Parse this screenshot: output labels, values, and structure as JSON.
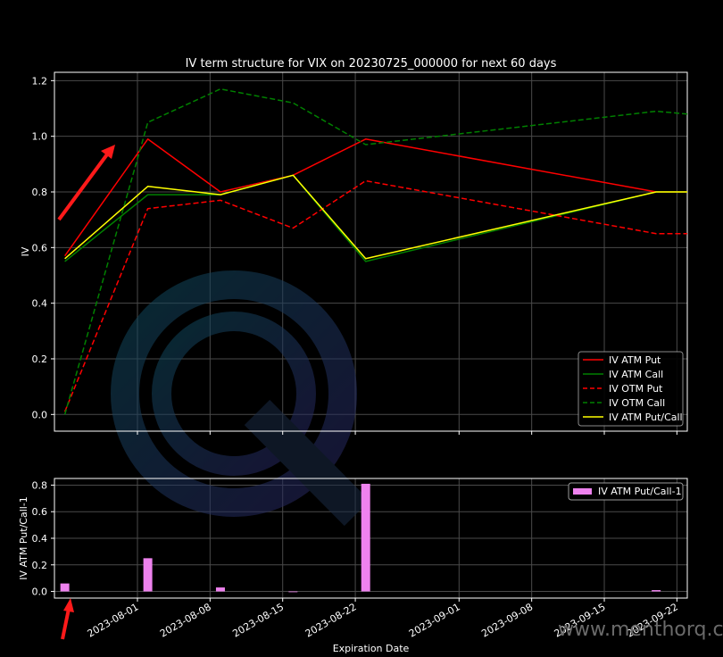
{
  "watermark_text": "www.menthorq.com",
  "chart_data": [
    {
      "type": "line",
      "title": "IV term structure for VIX on 20230725_000000 for next 60 days",
      "xlabel": "",
      "ylabel": "IV",
      "xlim": [
        "2023-07-24",
        "2023-09-23"
      ],
      "ylim": [
        -0.06,
        1.23
      ],
      "yticks": [
        "0.0",
        "0.2",
        "0.4",
        "0.6",
        "0.8",
        "1.0",
        "1.2"
      ],
      "grid": true,
      "legend_position": "lower-right",
      "x": [
        "2023-07-25",
        "2023-08-02",
        "2023-08-09",
        "2023-08-16",
        "2023-08-23",
        "2023-09-20",
        "2023-09-23"
      ],
      "series": [
        {
          "name": "IV ATM Put",
          "color": "#ff0000",
          "dash": "solid",
          "values": [
            0.57,
            0.99,
            0.8,
            0.86,
            0.99,
            0.8,
            0.8
          ]
        },
        {
          "name": "IV ATM Call",
          "color": "#008000",
          "dash": "solid",
          "values": [
            0.55,
            0.79,
            0.79,
            0.86,
            0.55,
            0.8,
            0.8
          ]
        },
        {
          "name": "IV OTM Put",
          "color": "#ff0000",
          "dash": "dashed",
          "values": [
            0.01,
            0.74,
            0.77,
            0.67,
            0.84,
            0.65,
            0.65
          ]
        },
        {
          "name": "IV OTM Call",
          "color": "#008000",
          "dash": "dashed",
          "values": [
            0.0,
            1.05,
            1.17,
            1.12,
            0.97,
            1.09,
            1.08
          ]
        },
        {
          "name": "IV ATM Put/Call",
          "color": "#ffff00",
          "dash": "solid",
          "values": [
            0.56,
            0.82,
            0.79,
            0.86,
            0.56,
            0.8,
            0.8
          ]
        }
      ]
    },
    {
      "type": "bar",
      "xlabel": "Expiration Date",
      "ylabel": "IV ATM Put/Call-1",
      "xlim": [
        "2023-07-24",
        "2023-09-23"
      ],
      "ylim": [
        -0.05,
        0.85
      ],
      "yticks": [
        "0.0",
        "0.2",
        "0.4",
        "0.6",
        "0.8"
      ],
      "xticks": [
        "2023-08-01",
        "2023-08-08",
        "2023-08-15",
        "2023-08-22",
        "2023-09-01",
        "2023-09-08",
        "2023-09-15",
        "2023-09-22"
      ],
      "grid": true,
      "legend_position": "upper-right",
      "color": "#ee82ee",
      "series": [
        {
          "name": "IV ATM Put/Call-1",
          "x": [
            "2023-07-25",
            "2023-08-02",
            "2023-08-09",
            "2023-08-16",
            "2023-08-23",
            "2023-09-20"
          ],
          "values": [
            0.06,
            0.25,
            0.03,
            0.0,
            0.81,
            0.01
          ]
        }
      ]
    }
  ]
}
